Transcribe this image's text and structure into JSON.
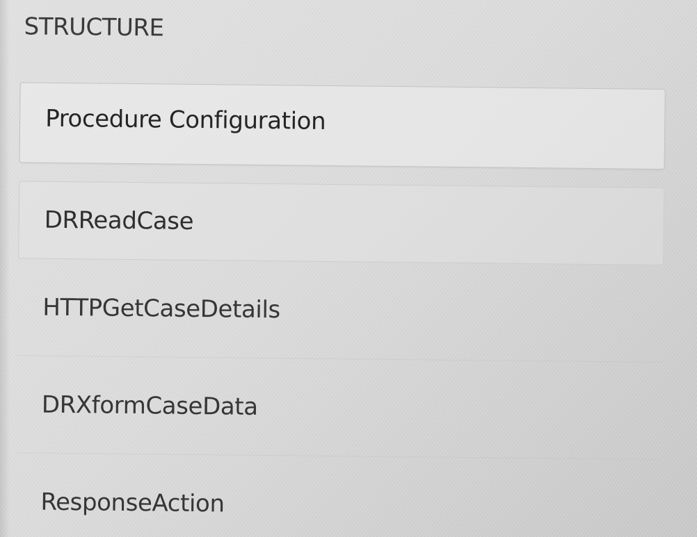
{
  "section": {
    "title": "STRUCTURE"
  },
  "structure": {
    "items": [
      {
        "label": "Procedure Configuration",
        "selected": true
      },
      {
        "label": "DRReadCase",
        "selected": false
      },
      {
        "label": "HTTPGetCaseDetails",
        "selected": false
      },
      {
        "label": "DRXformCaseData",
        "selected": false
      },
      {
        "label": "ResponseAction",
        "selected": false
      }
    ]
  }
}
